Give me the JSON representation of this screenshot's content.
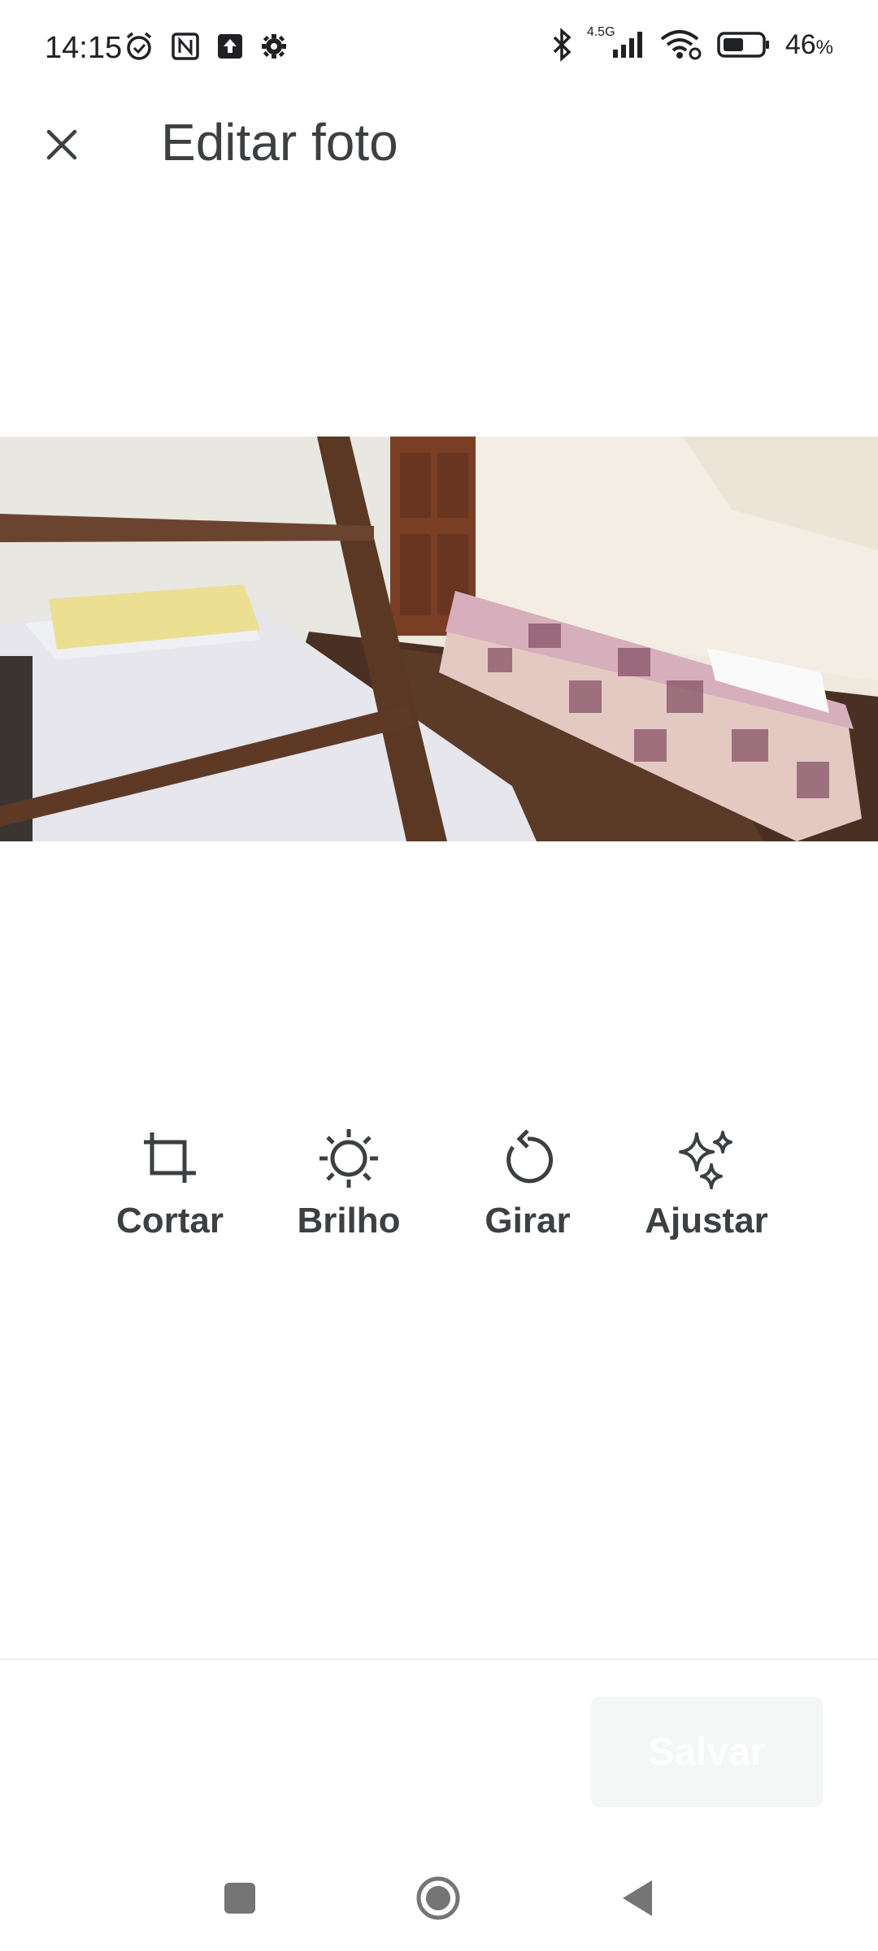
{
  "status_bar": {
    "time": "14:15",
    "network": "4.5G",
    "battery_level": "46",
    "battery_unit": "%",
    "icons_left": [
      "alarm-icon",
      "nfc-icon",
      "upload-icon",
      "settings-icon"
    ],
    "icons_right": [
      "bluetooth-icon",
      "signal-icon",
      "wifi-icon",
      "battery-icon"
    ]
  },
  "app_bar": {
    "title": "Editar foto",
    "close_icon": "close-icon"
  },
  "photo": {
    "description_icon": "photo"
  },
  "tools": [
    {
      "label": "Cortar",
      "icon": "crop-icon"
    },
    {
      "label": "Brilho",
      "icon": "brightness-icon"
    },
    {
      "label": "Girar",
      "icon": "rotate-icon"
    },
    {
      "label": "Ajustar",
      "icon": "sparkle-icon"
    }
  ],
  "footer": {
    "save_label": "Salvar"
  },
  "nav_bar": {
    "items": [
      "recents-icon",
      "home-icon",
      "back-icon"
    ]
  },
  "colors": {
    "text": "#3c4043",
    "save_bg": "#f3f7f6",
    "divider": "#eeeeee"
  }
}
